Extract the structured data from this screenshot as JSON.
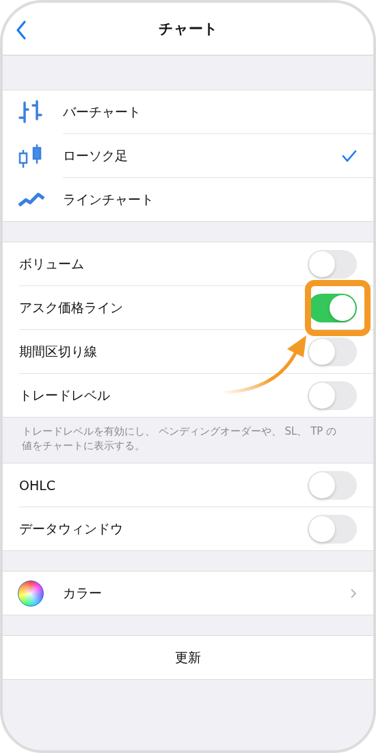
{
  "header": {
    "title": "チャート"
  },
  "chart_types": [
    {
      "kind": "bar",
      "label": "バーチャート",
      "selected": false
    },
    {
      "kind": "candle",
      "label": "ローソク足",
      "selected": true
    },
    {
      "kind": "line",
      "label": "ラインチャート",
      "selected": false
    }
  ],
  "indicators": [
    {
      "label": "ボリューム",
      "on": false,
      "highlighted": false
    },
    {
      "label": "アスク価格ライン",
      "on": true,
      "highlighted": true
    },
    {
      "label": "期間区切り線",
      "on": false,
      "highlighted": false
    },
    {
      "label": "トレードレベル",
      "on": false,
      "highlighted": false
    }
  ],
  "indicators_note": "トレードレベルを有効にし、 ペンディングオーダーや、 SL、 TP の値をチャートに表示する。",
  "data_options": [
    {
      "label": "OHLC",
      "on": false
    },
    {
      "label": "データウィンドウ",
      "on": false
    }
  ],
  "color_row": {
    "label": "カラー"
  },
  "update_button": {
    "label": "更新"
  }
}
